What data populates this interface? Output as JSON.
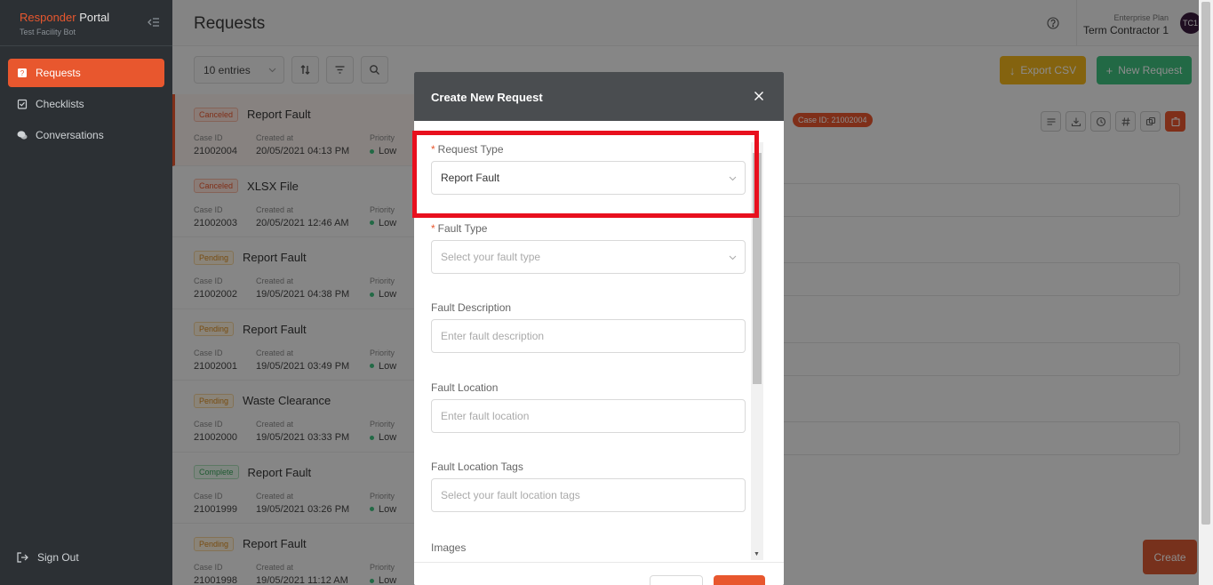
{
  "sidebar": {
    "brand_part1": "Responder",
    "brand_part2": " Portal",
    "subtitle": "Test Facility Bot",
    "items": [
      {
        "label": "Requests",
        "icon": "request-icon",
        "active": true
      },
      {
        "label": "Checklists",
        "icon": "checklist-icon"
      },
      {
        "label": "Conversations",
        "icon": "chat-icon"
      }
    ],
    "signout": "Sign Out"
  },
  "header": {
    "title": "Requests",
    "plan_label": "Enterprise Plan",
    "user": "Term Contractor 1",
    "avatar": "TC1"
  },
  "toolbar": {
    "entries": "10 entries",
    "export": "Export CSV",
    "new_request": "New Request"
  },
  "requests": [
    {
      "status": "Canceled",
      "title": "Report Fault",
      "case_id": "21002004",
      "created": "20/05/2021 04:13 PM",
      "priority": "Low"
    },
    {
      "status": "Canceled",
      "title": "XLSX File",
      "case_id": "21002003",
      "created": "20/05/2021 12:46 AM",
      "priority": "Low"
    },
    {
      "status": "Pending",
      "title": "Report Fault",
      "case_id": "21002002",
      "created": "19/05/2021 04:38 PM",
      "priority": "Low"
    },
    {
      "status": "Pending",
      "title": "Report Fault",
      "case_id": "21002001",
      "created": "19/05/2021 03:49 PM",
      "priority": "Low"
    },
    {
      "status": "Pending",
      "title": "Waste Clearance",
      "case_id": "21002000",
      "created": "19/05/2021 03:33 PM",
      "priority": "Low"
    },
    {
      "status": "Complete",
      "title": "Report Fault",
      "case_id": "21001999",
      "created": "19/05/2021 03:26 PM",
      "priority": "Low"
    },
    {
      "status": "Pending",
      "title": "Report Fault",
      "case_id": "21001998",
      "created": "19/05/2021 11:12 AM",
      "priority": "Low"
    }
  ],
  "labels": {
    "case_id": "Case ID",
    "created_at": "Created at",
    "priority": "Priority"
  },
  "detail": {
    "case_badge": "Case ID: 21002004",
    "create_label": "Create"
  },
  "modal": {
    "title": "Create New Request",
    "request_type_label": "Request Type",
    "request_type_value": "Report Fault",
    "fault_type_label": "Fault Type",
    "fault_type_placeholder": "Select your fault type",
    "fault_desc_label": "Fault Description",
    "fault_desc_placeholder": "Enter fault description",
    "fault_loc_label": "Fault Location",
    "fault_loc_placeholder": "Enter fault location",
    "fault_tags_label": "Fault Location Tags",
    "fault_tags_placeholder": "Select your fault location tags",
    "images_label": "Images",
    "required_mark": "*"
  },
  "colors": {
    "accent": "#e8572e",
    "highlight": "#e8101e",
    "export": "#f0b41d",
    "new": "#3fbf7f"
  }
}
